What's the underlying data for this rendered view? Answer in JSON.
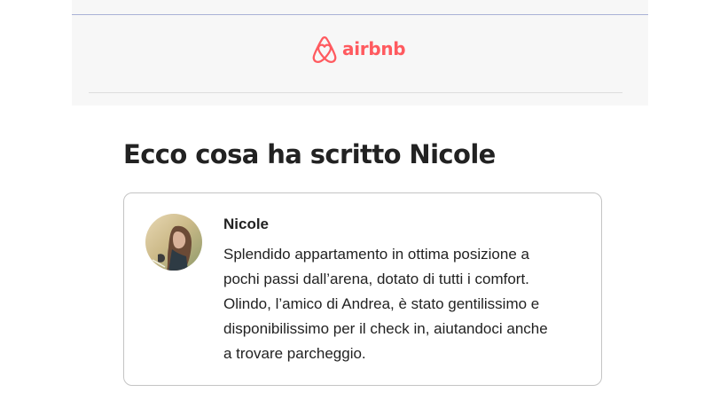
{
  "brand": {
    "name": "airbnb",
    "color": "#ff5a5f",
    "logo_icon": "airbnb-belo-icon"
  },
  "main": {
    "title": "Ecco cosa ha scritto Nicole"
  },
  "review": {
    "avatar_icon": "reviewer-avatar",
    "author": "Nicole",
    "text_lines": [
      "Splendido appartamento in ottima posizione a",
      "pochi passi dall’arena, dotato di tutti i comfort.",
      "Olindo, l’amico di Andrea, è stato gentilissimo e",
      "disponibilissimo per il check in, aiutandoci anche",
      "a trovare parcheggio."
    ]
  }
}
